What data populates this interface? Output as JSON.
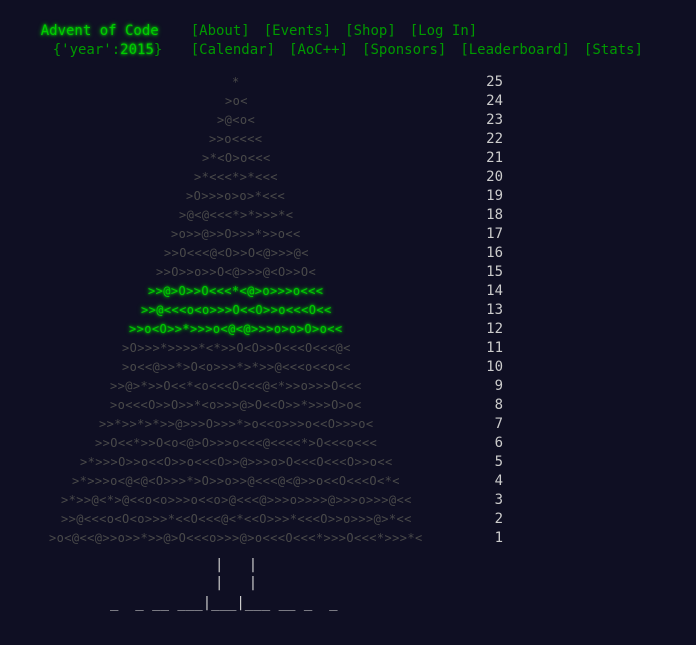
{
  "header": {
    "title": "Advent of Code",
    "year_prefix": "{'year':",
    "year_value": "2015",
    "year_suffix": "}",
    "nav_row1": [
      "[About]",
      "[Events]",
      "[Shop]",
      "[Log In]"
    ],
    "nav_row2": [
      "[Calendar]",
      "[AoC++]",
      "[Sponsors]",
      "[Leaderboard]",
      "[Stats]"
    ]
  },
  "calendar": {
    "lit_color": "#00cc00",
    "dim_color": "#4a4a4a",
    "lines": [
      {
        "day": "25",
        "text": "*",
        "lit": false
      },
      {
        "day": "24",
        "text": ">o<",
        "lit": false
      },
      {
        "day": "23",
        "text": ">@<o<",
        "lit": false
      },
      {
        "day": "22",
        "text": ">>o<<<<",
        "lit": false
      },
      {
        "day": "21",
        "text": ">*<O>o<<<",
        "lit": false
      },
      {
        "day": "20",
        "text": ">*<<<*>*<<<",
        "lit": false
      },
      {
        "day": "19",
        "text": ">O>>>o>o>*<<<",
        "lit": false
      },
      {
        "day": "18",
        "text": ">@<@<<<*>*>>>*<",
        "lit": false
      },
      {
        "day": "17",
        "text": ">o>>@>>O>>>*>>o<<",
        "lit": false
      },
      {
        "day": "16",
        "text": ">>O<<<@<O>>O<@>>>@<",
        "lit": false
      },
      {
        "day": "15",
        "text": ">>O>>o>>O<@>>>@<O>>O<",
        "lit": false
      },
      {
        "day": "14",
        "text": ">>@>O>>O<<<*<@>o>>>o<<<",
        "lit": true
      },
      {
        "day": "13",
        "text": ">>@<<<o<o>>>O<<O>>o<<<O<<",
        "lit": true
      },
      {
        "day": "12",
        "text": ">>o<O>>*>>>o<@<@>>>o>o>O>o<<",
        "lit": true
      },
      {
        "day": "11",
        "text": ">O>>>*>>>>*<*>>O<O>>O<<<O<<<@<",
        "lit": false
      },
      {
        "day": "10",
        "text": ">o<<@>>*>O<o>>>*>*>>@<<<o<<o<<",
        "lit": false
      },
      {
        "day": "9",
        "text": ">>@>*>>O<<*<o<<<O<<<@<*>>o>>>O<<<",
        "lit": false
      },
      {
        "day": "8",
        "text": ">o<<<O>>O>>*<o>>>@>O<<O>>*>>>O>o<",
        "lit": false
      },
      {
        "day": "7",
        "text": ">>*>>*>*>>@>>>O>>>*>o<<o>>>o<<O>>>o<",
        "lit": false
      },
      {
        "day": "6",
        "text": ">>O<<*>>O<o<@>O>>>o<<<@<<<<*>O<<<o<<<",
        "lit": false
      },
      {
        "day": "5",
        "text": ">*>>>O>>o<<O>>o<<<O>>@>>>o>O<<<O<<<O>>o<<",
        "lit": false
      },
      {
        "day": "4",
        "text": ">*>>>o<@<@<O>>>*>O>>o>>@<<<@<@>>o<<O<<<O<*<",
        "lit": false
      },
      {
        "day": "3",
        "text": ">*>>@<*>@<<o<o>>>o<<o>@<<<@>>>o>>>>@>>>o>>>@<<",
        "lit": false
      },
      {
        "day": "2",
        "text": ">>@<<<o<O<o>>>*<<O<<<@<*<<O>>>*<<<O>>o>>>@>*<<",
        "lit": false
      },
      {
        "day": "1",
        "text": ">o<@<<@>>o>>*>>@>O<<<o>>>@>o<<<O<<<*>>>O<<<*>>>*<",
        "lit": false
      }
    ]
  },
  "trunk": {
    "lines": [
      "|   |",
      "|   |"
    ],
    "ground": "_  _ __ ___|___|___ __ _  _"
  }
}
